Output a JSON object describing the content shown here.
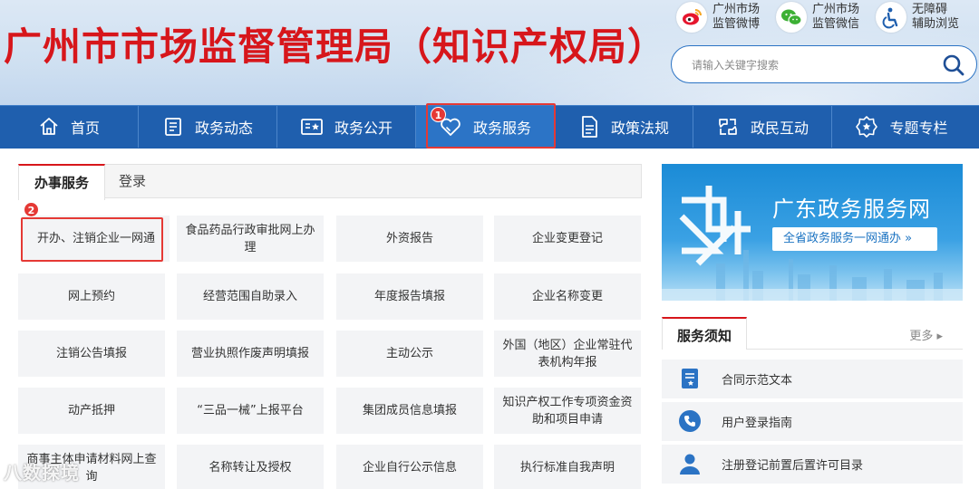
{
  "header": {
    "title": "广州市市场监督管理局（知识产权局）",
    "quick_links": [
      {
        "icon": "weibo-icon",
        "label": "广州市场\n监管微博"
      },
      {
        "icon": "wechat-icon",
        "label": "广州市场\n监管微信"
      },
      {
        "icon": "accessibility-icon",
        "label": "无障碍\n辅助浏览"
      }
    ],
    "search": {
      "placeholder": "请输入关键字搜索"
    }
  },
  "nav": {
    "items": [
      {
        "label": "首页",
        "icon": "home-icon"
      },
      {
        "label": "政务动态",
        "icon": "news-icon"
      },
      {
        "label": "政务公开",
        "icon": "open-gov-icon"
      },
      {
        "label": "政务服务",
        "icon": "heart-icon"
      },
      {
        "label": "政策法规",
        "icon": "document-icon"
      },
      {
        "label": "政民互动",
        "icon": "interaction-icon"
      },
      {
        "label": "专题专栏",
        "icon": "topic-badge-icon"
      }
    ],
    "active_index": 3
  },
  "annotations": {
    "badge_1": "1",
    "badge_2": "2"
  },
  "tabs": {
    "active": "办事服务",
    "other": "登录"
  },
  "services": [
    "开办、注销企业一网通",
    "食品药品行政审批网上办理",
    "外资报告",
    "企业变更登记",
    "网上预约",
    "经营范围自助录入",
    "年度报告填报",
    "企业名称变更",
    "注销公告填报",
    "营业执照作废声明填报",
    "主动公示",
    "外国（地区）企业常驻代表机构年报",
    "动产抵押",
    "“三品一械”上报平台",
    "集团成员信息填报",
    "知识产权工作专项资金资助和项目申请",
    "商事主体申请材料网上查询",
    "名称转让及授权",
    "企业自行公示信息",
    "执行标准自我声明"
  ],
  "banner": {
    "title": "广东政务服务网",
    "button": "全省政务服务一网通办 »"
  },
  "notice": {
    "title": "服务须知",
    "more": "更多 ▸",
    "items": [
      {
        "label": "合同示范文本",
        "icon": "contract-icon"
      },
      {
        "label": "用户登录指南",
        "icon": "phone-icon"
      },
      {
        "label": "注册登记前置后置许可目录",
        "icon": "user-icon"
      }
    ]
  },
  "watermark": "八数探境",
  "colors": {
    "brand_red": "#d7161b",
    "nav_blue": "#1f5fae",
    "highlight_red": "#e53935"
  }
}
